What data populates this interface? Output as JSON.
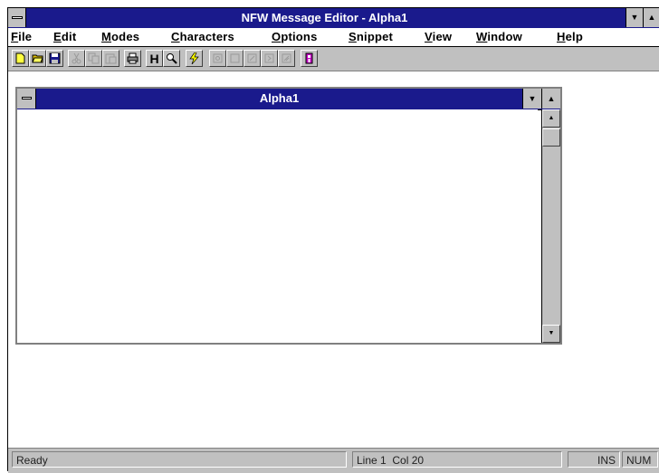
{
  "window": {
    "title": "NFW Message Editor - Alpha1"
  },
  "menu": {
    "items": [
      {
        "label": "File",
        "mnemonic": "F",
        "rest": "ile"
      },
      {
        "label": "Edit",
        "mnemonic": "E",
        "rest": "dit"
      },
      {
        "label": "Modes",
        "mnemonic": "M",
        "rest": "odes"
      },
      {
        "label": "Characters",
        "mnemonic": "C",
        "rest": "haracters"
      },
      {
        "label": "Options",
        "mnemonic": "O",
        "rest": "ptions"
      },
      {
        "label": "Snippet",
        "mnemonic": "S",
        "rest": "nippet"
      },
      {
        "label": "View",
        "mnemonic": "V",
        "rest": "iew"
      },
      {
        "label": "Window",
        "mnemonic": "W",
        "rest": "indow"
      },
      {
        "label": "Help",
        "mnemonic": "H",
        "rest": "elp"
      }
    ]
  },
  "toolbar": {
    "buttons": [
      {
        "icon": "new-file-icon",
        "enabled": true
      },
      {
        "icon": "open-folder-icon",
        "enabled": true
      },
      {
        "icon": "save-icon",
        "enabled": true
      },
      {
        "icon": "cut-icon",
        "enabled": false
      },
      {
        "icon": "copy-icon",
        "enabled": false
      },
      {
        "icon": "paste-icon",
        "enabled": false
      },
      {
        "icon": "print-icon",
        "enabled": true
      },
      {
        "icon": "hold-icon",
        "enabled": true,
        "glyph": "H"
      },
      {
        "icon": "search-icon",
        "enabled": true
      },
      {
        "icon": "lightning-icon",
        "enabled": true
      },
      {
        "icon": "snippet-1-icon",
        "enabled": false
      },
      {
        "icon": "snippet-2-icon",
        "enabled": false
      },
      {
        "icon": "snippet-3-icon",
        "enabled": false
      },
      {
        "icon": "snippet-4-icon",
        "enabled": false
      },
      {
        "icon": "snippet-5-icon",
        "enabled": false
      },
      {
        "icon": "help-icon",
        "enabled": true
      }
    ]
  },
  "document": {
    "title": "Alpha1",
    "content": ""
  },
  "statusbar": {
    "status": "Ready",
    "position": "Line 1  Col 20",
    "ins": "INS",
    "num": "NUM"
  },
  "colors": {
    "titlebar": "#1a1a8c",
    "chrome": "#c0c0c0"
  }
}
